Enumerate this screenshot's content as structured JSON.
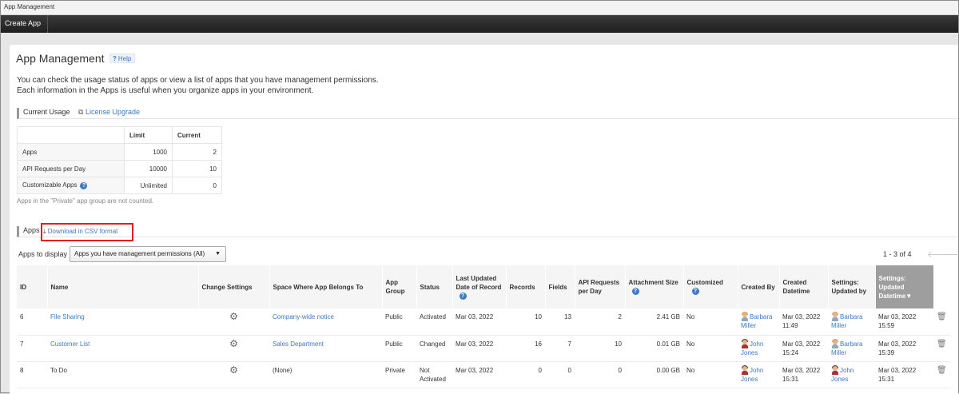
{
  "window": {
    "title": "App Management"
  },
  "toolbar": {
    "create_app": "Create App"
  },
  "header": {
    "title": "App Management",
    "help": "Help",
    "desc1": "You can check the usage status of apps or view a list of apps that you have management permissions.",
    "desc2": "Each information in the Apps is useful when you organize apps in your environment."
  },
  "usage": {
    "heading": "Current Usage",
    "license_link": "License Upgrade",
    "col_limit": "Limit",
    "col_current": "Current",
    "rows": [
      {
        "label": "Apps",
        "limit": "1000",
        "current": "2"
      },
      {
        "label": "API Requests per Day",
        "limit": "10000",
        "current": "10"
      },
      {
        "label": "Customizable Apps",
        "limit": "Unlimited",
        "current": "0"
      }
    ],
    "note": "Apps in the \"Private\" app group are not counted."
  },
  "apps": {
    "heading": "Apps",
    "csv_link": "Download in CSV format",
    "display_label": "Apps to display",
    "display_value": "Apps you have management permissions (All)",
    "pager": "1 - 3 of 4",
    "headers": {
      "id": "ID",
      "name": "Name",
      "change_settings": "Change Settings",
      "space": "Space Where App Belongs To",
      "group": "App Group",
      "status": "Status",
      "last_updated": "Last Updated Date of Record",
      "records": "Records",
      "fields": "Fields",
      "api": "API Requests per Day",
      "attachment": "Attachment Size",
      "customized": "Customized",
      "created_by": "Created By",
      "created_dt": "Created Datetime",
      "updated_by": "Settings: Updated by",
      "updated_dt": "Settings: Updated Datetime"
    },
    "rows": [
      {
        "id": "6",
        "name": "File Sharing",
        "space": "Company-wide notice",
        "group": "Public",
        "status": "Activated",
        "last_updated": "Mar 03, 2022",
        "records": "10",
        "fields": "13",
        "api": "2",
        "attachment": "2.41 GB",
        "customized": "No",
        "created_by": "Barbara Miller",
        "created_dt": "Mar 03, 2022 11:49",
        "updated_by": "Barbara Miller",
        "updated_dt": "Mar 03, 2022 15:59"
      },
      {
        "id": "7",
        "name": "Customer List",
        "space": "Sales Department",
        "group": "Public",
        "status": "Changed",
        "last_updated": "Mar 03, 2022",
        "records": "16",
        "fields": "7",
        "api": "10",
        "attachment": "0.01 GB",
        "customized": "No",
        "created_by": "John Jones",
        "created_dt": "Mar 03, 2022 15:24",
        "updated_by": "Barbara Miller",
        "updated_dt": "Mar 03, 2022 15:39"
      },
      {
        "id": "8",
        "name": "To Do",
        "space": "(None)",
        "group": "Private",
        "status": "Not Activated",
        "last_updated": "Mar 03, 2022",
        "records": "0",
        "fields": "0",
        "api": "0",
        "attachment": "0.00 GB",
        "customized": "No",
        "created_by": "John Jones",
        "created_dt": "Mar 03, 2022 15:31",
        "updated_by": "John Jones",
        "updated_dt": "Mar 03, 2022 15:31"
      }
    ]
  },
  "colors": {
    "link": "#3b7ac4",
    "highlight_box": "#e02020",
    "sorted_header": "#9e9e9e",
    "toolbar": "#2a2a2a"
  },
  "icons": [
    "help-icon",
    "license-icon",
    "info-icon",
    "download-icon",
    "chevron-down-icon",
    "arrow-left-icon",
    "arrow-right-icon",
    "gear-icon",
    "avatar-icon",
    "trash-icon",
    "sort-down-icon"
  ]
}
